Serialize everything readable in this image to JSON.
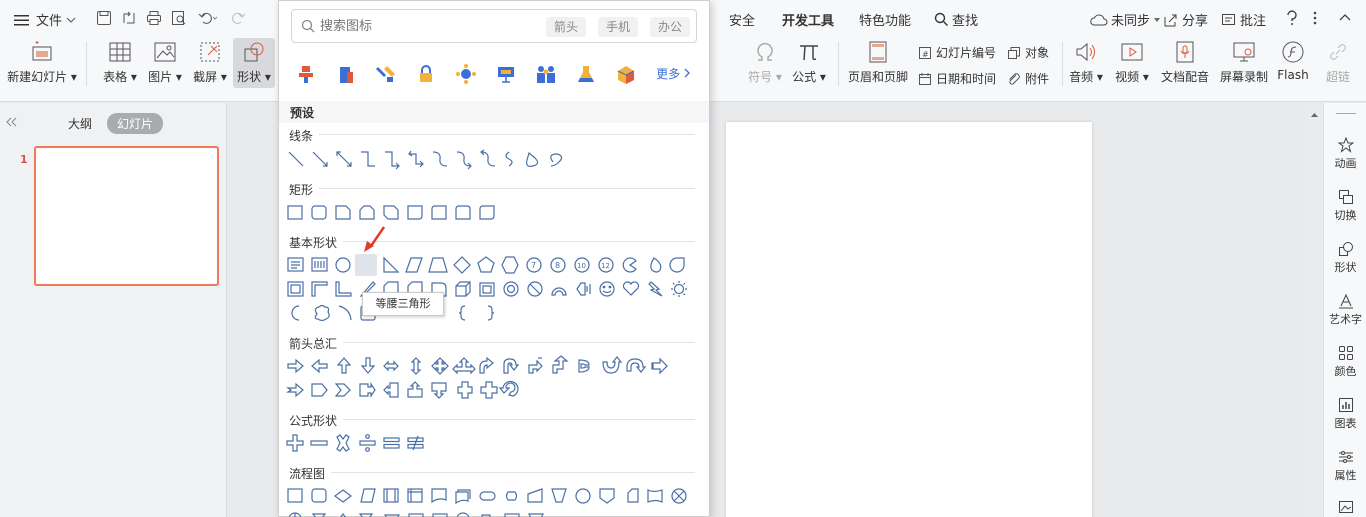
{
  "menu": {
    "file_label": "文件"
  },
  "tabs": [
    {
      "label": "安全",
      "bold": false
    },
    {
      "label": "开发工具",
      "bold": true
    },
    {
      "label": "特色功能",
      "bold": false
    },
    {
      "label": "查找",
      "bold": false
    }
  ],
  "status": {
    "sync_label": "未同步",
    "share_label": "分享",
    "comment_label": "批注"
  },
  "toolbar_left": [
    {
      "label": "新建幻灯片",
      "caret": true
    },
    {
      "label": "表格",
      "caret": true
    },
    {
      "label": "图片",
      "caret": true
    },
    {
      "label": "截屏",
      "caret": true
    },
    {
      "label": "形状",
      "caret": true
    }
  ],
  "toolbar_right": {
    "symbol_label": "符号",
    "formula_label": "公式",
    "header_footer_label": "页眉和页脚",
    "slide_number_label": "幻灯片编号",
    "object_label": "对象",
    "datetime_label": "日期和时间",
    "attachment_label": "附件",
    "audio_label": "音频",
    "video_label": "视频",
    "narration_label": "文档配音",
    "screen_record_label": "屏幕录制",
    "flash_label": "Flash",
    "hyperlink_label": "超链"
  },
  "left_panel": {
    "outline_tab": "大纲",
    "slides_tab": "幻灯片",
    "slide_number": "1"
  },
  "right_panel": [
    {
      "label": "动画",
      "icon": "animation-icon"
    },
    {
      "label": "切换",
      "icon": "transition-icon"
    },
    {
      "label": "形状",
      "icon": "shape-icon"
    },
    {
      "label": "艺术字",
      "icon": "wordart-icon"
    },
    {
      "label": "颜色",
      "icon": "color-icon"
    },
    {
      "label": "图表",
      "icon": "chart-icon"
    },
    {
      "label": "属性",
      "icon": "properties-icon"
    }
  ],
  "dropdown": {
    "search_placeholder": "搜索图标",
    "chips": [
      "箭头",
      "手机",
      "办公"
    ],
    "more_label": "更多",
    "preset_label": "预设",
    "categories": {
      "lines": "线条",
      "rectangles": "矩形",
      "basic": "基本形状",
      "arrows": "箭头总汇",
      "equation": "公式形状",
      "flowchart": "流程图"
    },
    "tooltip": "等腰三角形"
  },
  "colors": {
    "accent": "#3b6fd6",
    "shape_stroke": "#4a6fa5",
    "slide_border": "#f07a5a"
  }
}
